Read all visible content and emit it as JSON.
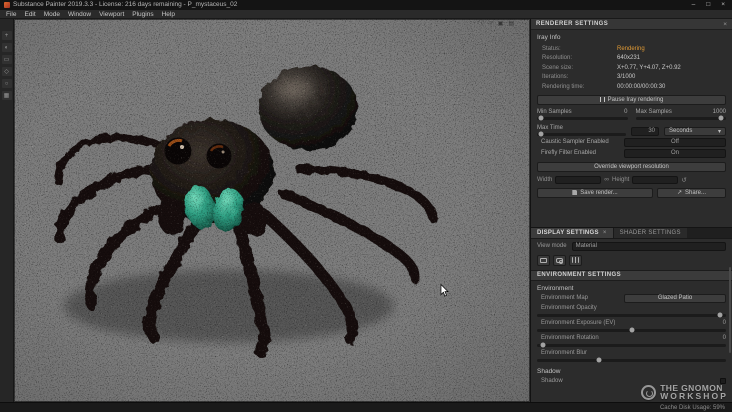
{
  "titlebar": {
    "app_title": "Substance Painter 2019.3.3 - License: 216 days remaining - P_mystaceus_02"
  },
  "menubar": {
    "items": [
      "File",
      "Edit",
      "Mode",
      "Window",
      "Viewport",
      "Plugins",
      "Help"
    ]
  },
  "glyphs": {
    "close": "×",
    "minimize": "–",
    "maximize": "□",
    "dropdown": "▾",
    "link": "∞",
    "reset": "↺",
    "share": "↗",
    "info": "ⓘ",
    "question": "?",
    "grid": "▣",
    "monitor": "▤"
  },
  "tools": {
    "items": [
      "+",
      "◐",
      "▭",
      "◇",
      "○",
      "▦"
    ]
  },
  "renderer": {
    "title": "RENDERER SETTINGS",
    "iray_info_title": "Iray Info",
    "rows": [
      {
        "label": "Status:",
        "value": "Rendering"
      },
      {
        "label": "Resolution:",
        "value": "640x231"
      },
      {
        "label": "Scene size:",
        "value": "X+0.77, Y+4.07, Z+0.92"
      },
      {
        "label": "Iterations:",
        "value": "3/1000"
      },
      {
        "label": "Rendering time:",
        "value": "00:00:00/00:00:30"
      }
    ],
    "pause_button": "Pause Iray rendering",
    "min_samples_label": "Min Samples",
    "min_samples_value": "0",
    "max_samples_label": "Max Samples",
    "max_samples_value": "1000",
    "max_time_label": "Max Time",
    "max_time_value": "30",
    "max_time_unit": "Seconds",
    "caustic_label": "Caustic Sampler Enabled",
    "caustic_value": "Off",
    "firefly_label": "Firefly Filter Enabled",
    "firefly_value": "On",
    "override_button": "Override viewport resolution",
    "width_label": "Width",
    "height_label": "Height",
    "save_button": "Save render...",
    "share_button": "Share..."
  },
  "display": {
    "tabs": [
      {
        "label": "DISPLAY SETTINGS"
      },
      {
        "label": "SHADER SETTINGS"
      }
    ],
    "view_mode_label": "View mode",
    "view_mode_value": "Material",
    "env_settings_title": "ENVIRONMENT SETTINGS",
    "environment_title": "Environment",
    "env_map_label": "Environment Map",
    "env_map_value": "Glazed Patio",
    "env_opacity_label": "Environment Opacity",
    "env_exposure_label": "Environment Exposure (EV)",
    "env_exposure_value": "0",
    "env_rotation_label": "Environment Rotation",
    "env_rotation_value": "0",
    "env_blur_label": "Environment Blur",
    "shadow_title": "Shadow",
    "shadow_label": "Shadow"
  },
  "statusbar": {
    "cache": "Cache Disk Usage: 59%"
  },
  "watermark": {
    "line1": "THE GNOMON",
    "line2": "WORKSHOP"
  },
  "colors": {
    "accent_orange": "#e09a35",
    "viewport_bg": "#7c7c7c",
    "chelicerae_teal": "#2fa184"
  }
}
